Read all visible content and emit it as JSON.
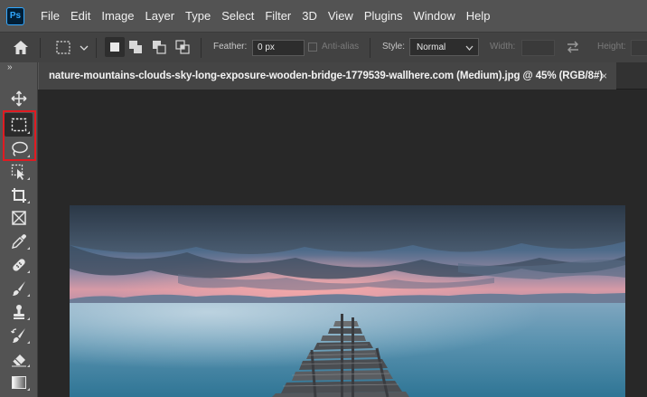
{
  "app": {
    "logo_text": "Ps"
  },
  "menu": [
    "File",
    "Edit",
    "Image",
    "Layer",
    "Type",
    "Select",
    "Filter",
    "3D",
    "View",
    "Plugins",
    "Window",
    "Help"
  ],
  "options_bar": {
    "feather_label": "Feather:",
    "feather_value": "0 px",
    "antialias_label": "Anti-alias",
    "style_label": "Style:",
    "style_value": "Normal",
    "width_label": "Width:",
    "height_label": "Height:"
  },
  "document": {
    "tab_title": "nature-mountains-clouds-sky-long-exposure-wooden-bridge-1779539-wallhere.com (Medium).jpg @ 45% (RGB/8#)",
    "close_glyph": "×"
  },
  "toolbar": {
    "collapse_glyph": "»",
    "tools": [
      "move",
      "rectangular-marquee",
      "lasso",
      "object-selection",
      "crop",
      "frame",
      "eyedropper",
      "spot-healing-brush",
      "brush",
      "clone-stamp",
      "history-brush",
      "eraser",
      "gradient"
    ],
    "active_tool": "rectangular-marquee"
  },
  "annotation": {
    "highlight_color": "#e01b22",
    "arrow_color": "#e01b22"
  }
}
